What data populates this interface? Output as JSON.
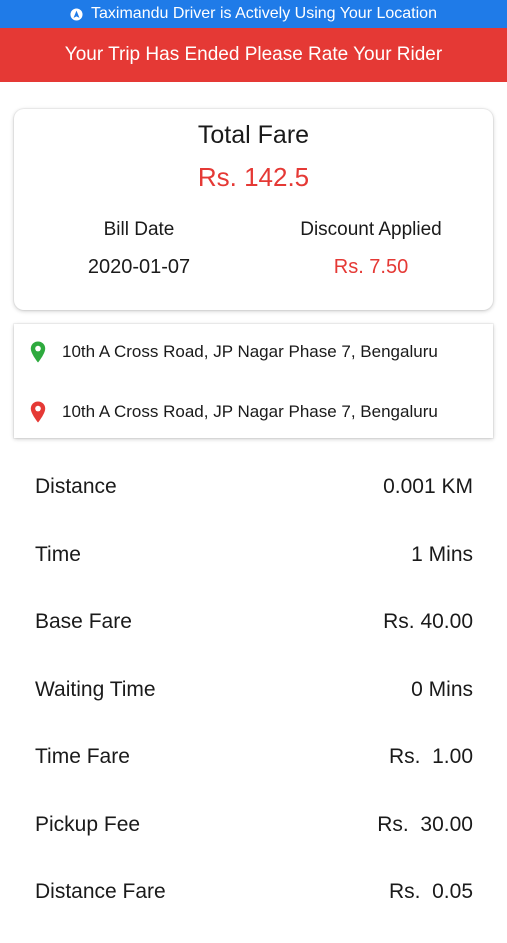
{
  "status_bar": {
    "location_text": "Taximandu Driver is Actively Using Your Location",
    "location_icon": "location-arrow-icon"
  },
  "banner": {
    "text": "Your Trip Has Ended Please Rate Your Rider",
    "color": "#e53935"
  },
  "fare_card": {
    "title": "Total Fare",
    "amount": "Rs. 142.5",
    "bill_date_label": "Bill Date",
    "bill_date_value": "2020-01-07",
    "discount_label": "Discount Applied",
    "discount_value": "Rs. 7.50"
  },
  "addresses": {
    "pickup": {
      "icon": "green-map-pin-icon",
      "text": "10th A Cross Road, JP Nagar Phase 7, Bengaluru",
      "color": "#2eaa3e"
    },
    "drop": {
      "icon": "red-map-pin-icon",
      "text": "10th A Cross Road, JP Nagar Phase 7, Bengaluru",
      "color": "#e53935"
    }
  },
  "details": [
    {
      "label": "Distance",
      "value": "0.001 KM"
    },
    {
      "label": "Time",
      "value": "1 Mins"
    },
    {
      "label": "Base Fare",
      "value": "Rs. 40.00"
    },
    {
      "label": "Waiting Time",
      "value": "0 Mins"
    },
    {
      "label": "Time Fare",
      "value": "Rs.  1.00"
    },
    {
      "label": "Pickup Fee",
      "value": "Rs.  30.00"
    },
    {
      "label": "Distance Fare",
      "value": "Rs.  0.05"
    }
  ],
  "colors": {
    "status_bar": "#1f7be8",
    "accent_red": "#e53935",
    "pin_green": "#2eaa3e"
  }
}
